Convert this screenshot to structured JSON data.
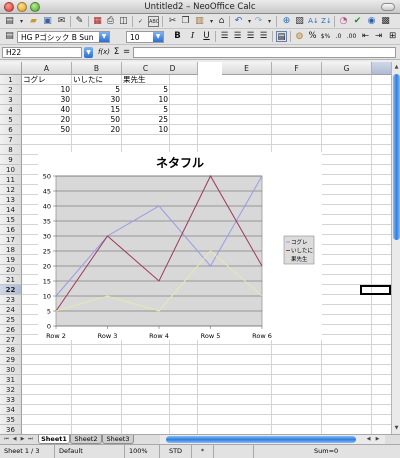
{
  "window": {
    "title": "Untitled2 – NeoOffice Calc"
  },
  "toolbar2": {
    "font_name": "HG Pゴシック B Sun",
    "font_size": "10",
    "bold": "B",
    "italic": "I",
    "underline": "U"
  },
  "formula_bar": {
    "cell_ref": "H22",
    "fx": "f(x)",
    "sum": "Σ",
    "equals": "="
  },
  "grid": {
    "columns": [
      "A",
      "B",
      "C",
      "D",
      "E",
      "F",
      "G",
      "H"
    ],
    "selected_column": "H",
    "rows": [
      "1",
      "2",
      "3",
      "4",
      "5",
      "6",
      "7",
      "8",
      "9",
      "10",
      "11",
      "12",
      "13",
      "14",
      "15",
      "16",
      "17",
      "18",
      "19",
      "20",
      "21",
      "22",
      "23",
      "24",
      "25",
      "26",
      "27",
      "28",
      "29",
      "30",
      "31",
      "32",
      "33",
      "34",
      "35",
      "36"
    ],
    "selected_row": "22",
    "header_row": [
      "コグレ",
      "いしたに",
      "果先生"
    ],
    "data_rows": [
      [
        "10",
        "5",
        "5"
      ],
      [
        "30",
        "30",
        "10"
      ],
      [
        "40",
        "15",
        "5"
      ],
      [
        "20",
        "50",
        "25"
      ],
      [
        "50",
        "20",
        "10"
      ]
    ]
  },
  "chart_data": {
    "type": "line",
    "title": "ネタフル",
    "categories": [
      "Row 2",
      "Row 3",
      "Row 4",
      "Row 5",
      "Row 6"
    ],
    "ylim": [
      0,
      50
    ],
    "yticks": [
      "0",
      "5",
      "10",
      "15",
      "20",
      "25",
      "30",
      "35",
      "40",
      "45",
      "50"
    ],
    "grid": true,
    "legend_position": "right",
    "series": [
      {
        "name": "コグレ",
        "values": [
          10,
          30,
          40,
          20,
          50
        ],
        "color": "#9a9ae8"
      },
      {
        "name": "いしたに",
        "values": [
          5,
          30,
          15,
          50,
          20
        ],
        "color": "#9e3a5a"
      },
      {
        "name": "果先生",
        "values": [
          5,
          10,
          5,
          25,
          10
        ],
        "color": "#e8e8b0"
      }
    ],
    "plot_background": "#d8d8d8"
  },
  "sheets": {
    "tabs": [
      "Sheet1",
      "Sheet2",
      "Sheet3"
    ],
    "active": "Sheet1"
  },
  "status": {
    "sheet": "Sheet 1 / 3",
    "page_style": "Default",
    "zoom": "100%",
    "mode": "STD",
    "modified": "*",
    "sum": "Sum=0"
  }
}
